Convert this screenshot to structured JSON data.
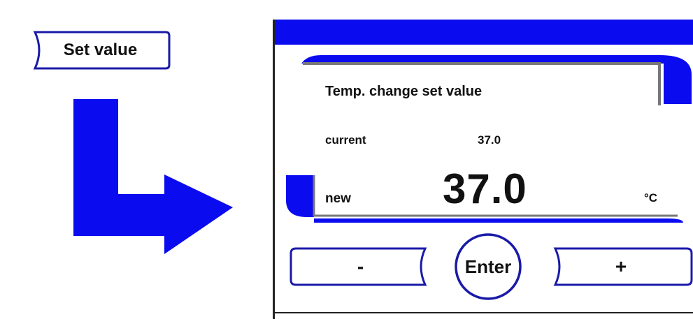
{
  "left": {
    "set_value_button": "Set value"
  },
  "dialog": {
    "title": "Temp. change set value",
    "current_label": "current",
    "current_value": "37.0",
    "new_label": "new",
    "new_value": "37.0",
    "unit": "°C",
    "minus_label": "-",
    "enter_label": "Enter",
    "plus_label": "+"
  },
  "colors": {
    "accent": "#0b0bf0",
    "outline": "#1a1aa8",
    "text": "#111111"
  }
}
